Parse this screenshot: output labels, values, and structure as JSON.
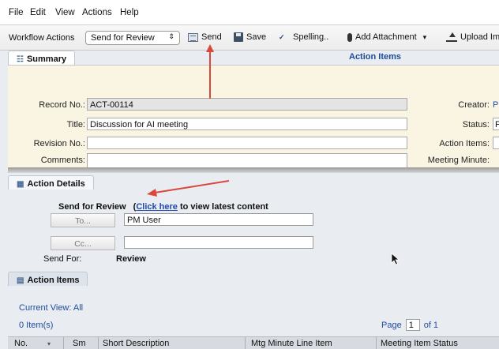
{
  "menu": [
    "File",
    "Edit",
    "View",
    "Actions",
    "Help"
  ],
  "toolbar": {
    "workflow_label": "Workflow Actions",
    "workflow_select": "Send for Review",
    "send": "Send",
    "save": "Save",
    "spelling": "Spelling..",
    "add_attachment": "Add Attachment",
    "add_attachment_caret": "▾",
    "upload": "Upload Im"
  },
  "summary": {
    "tab": "Summary",
    "title_right": "Action Items",
    "record_no_label": "Record No.:",
    "record_no": "ACT-00114",
    "title_label": "Title:",
    "title": "Discussion for AI meeting",
    "revision_label": "Revision No.:",
    "revision": "",
    "comments_label": "Comments:",
    "comments": "",
    "creator_label": "Creator:",
    "creator_value": "P",
    "status_label": "Status:",
    "status_value": "F",
    "action_items_label": "Action Items:",
    "meeting_minute_label": "Meeting Minute:"
  },
  "details": {
    "tab": "Action Details",
    "send_for_review": "Send for Review",
    "open_paren": "(",
    "click_here": "Click here",
    "to_view": "to view latest content",
    "to_button": "To...",
    "to_value": "PM User",
    "cc_button": "Cc...",
    "cc_value": "",
    "send_for_label": "Send For:",
    "send_for_value": "Review"
  },
  "items": {
    "tab": "Action Items",
    "current_view": "Current View: All",
    "count": "0 Item(s)",
    "page_label": "Page",
    "page_value": "1",
    "of_label": "of 1",
    "columns": [
      "No.",
      "Sm",
      "Short Description",
      "Mtg Minute Line Item",
      "Meeting Item Status"
    ]
  },
  "colors": {
    "accent": "#1f4a9b",
    "annotation_arrow": "#d9483b",
    "summary_bg": "#faf5e3",
    "panel_bg": "#e9edf2"
  }
}
